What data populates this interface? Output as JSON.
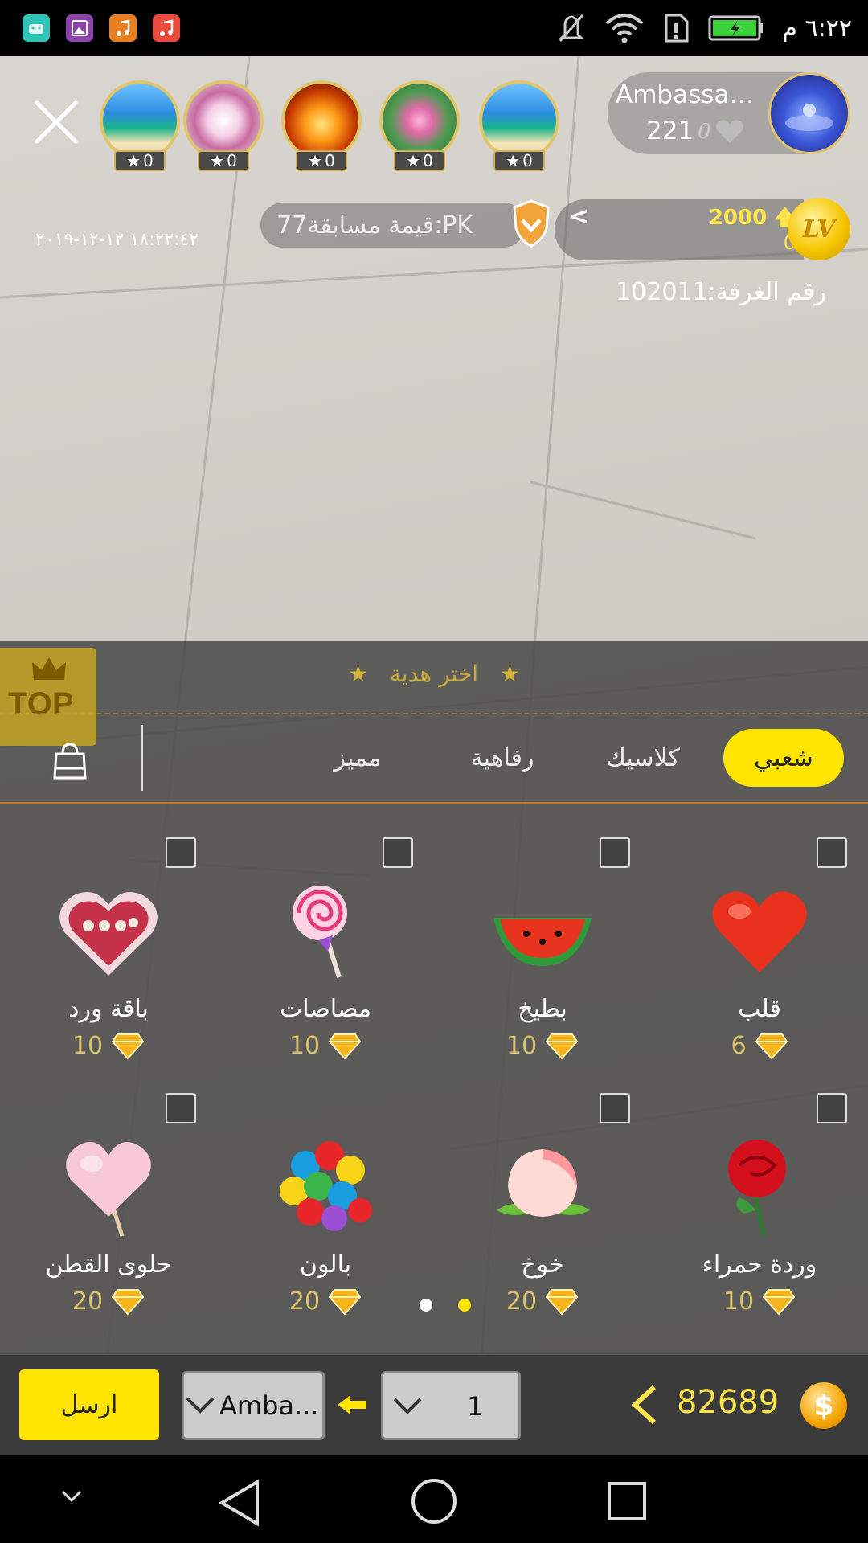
{
  "status_bar": {
    "time": "٦:٢٢ م",
    "app_icons": [
      {
        "name": "android-app-icon",
        "color": "#2ec4b6"
      },
      {
        "name": "gallery-app-icon",
        "color": "#8e44ad"
      },
      {
        "name": "music-app-icon",
        "color": "#e67e22"
      },
      {
        "name": "music-app-icon-2",
        "color": "#e74c3c"
      }
    ]
  },
  "host": {
    "name": "Ambassad...",
    "fans": "221",
    "hearts": "0"
  },
  "viewers": [
    {
      "level": "0",
      "theme": "beach"
    },
    {
      "level": "0",
      "theme": "flowers"
    },
    {
      "level": "0",
      "theme": "fire"
    },
    {
      "level": "0",
      "theme": "lotus"
    },
    {
      "level": "0",
      "theme": "beach"
    }
  ],
  "pk": {
    "label": "قيمة مسابقة77:PK"
  },
  "stream_date": "١٨:٢٢:٤٢ ١٢-١٢-٢٠١٩",
  "level": {
    "top_value": "2000",
    "bottom_value": "0",
    "badge": "LV"
  },
  "room": {
    "label": "رقم الغرفة:102011"
  },
  "top_badge": {
    "label": "TOP"
  },
  "gift_panel": {
    "title": "اختر هدية",
    "tabs": [
      {
        "label": "شعبي",
        "active": true
      },
      {
        "label": "كلاسيك",
        "active": false
      },
      {
        "label": "رفاهية",
        "active": false
      },
      {
        "label": "مميز",
        "active": false
      }
    ],
    "gifts": [
      {
        "name": "قلب",
        "price": "6",
        "icon": "heart-gift-icon"
      },
      {
        "name": "بطيخ",
        "price": "10",
        "icon": "watermelon-gift-icon"
      },
      {
        "name": "مصاصات",
        "price": "10",
        "icon": "lollipop-gift-icon"
      },
      {
        "name": "باقة ورد",
        "price": "10",
        "icon": "rose-box-gift-icon"
      },
      {
        "name": "وردة حمراء",
        "price": "10",
        "icon": "red-rose-gift-icon"
      },
      {
        "name": "خوخ",
        "price": "20",
        "icon": "peach-gift-icon"
      },
      {
        "name": "بالون",
        "price": "20",
        "icon": "balloons-gift-icon"
      },
      {
        "name": "حلوى القطن",
        "price": "20",
        "icon": "cotton-candy-gift-icon"
      }
    ],
    "page_current": 2,
    "page_total": 2
  },
  "send_bar": {
    "send_label": "ارسل",
    "recipient": "Amba...",
    "quantity": "1",
    "balance": "82689"
  },
  "colors": {
    "accent_yellow": "#ffe400",
    "gold": "#d8c26a",
    "panel_bg": "#464646"
  }
}
